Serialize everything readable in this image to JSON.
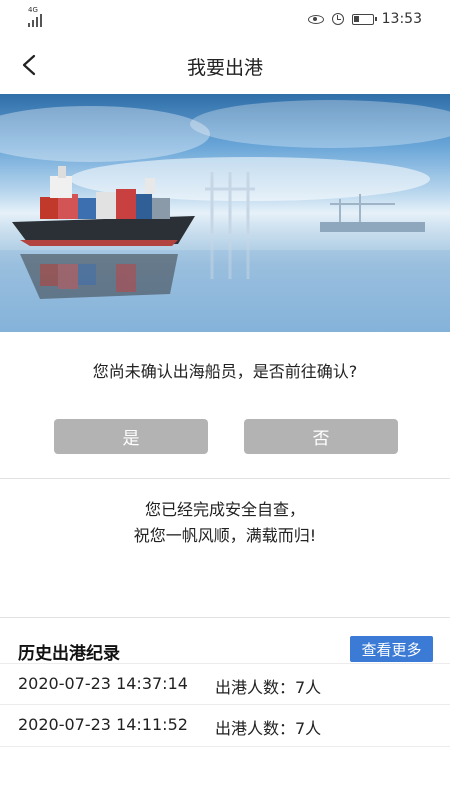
{
  "status_bar": {
    "network": "4G",
    "time": "13:53"
  },
  "header": {
    "title": "我要出港"
  },
  "prompt": {
    "question": "您尚未确认出海船员，是否前往确认?",
    "yes_label": "是",
    "no_label": "否"
  },
  "message": {
    "line1": "您已经完成安全自查，",
    "line2": "祝您一帆风顺，满载而归!"
  },
  "history": {
    "title": "历史出港纪录",
    "more_label": "查看更多",
    "records": [
      {
        "time": "2020-07-23 14:37:14",
        "count": "出港人数：7人"
      },
      {
        "time": "2020-07-23 14:11:52",
        "count": "出港人数：7人"
      }
    ]
  }
}
